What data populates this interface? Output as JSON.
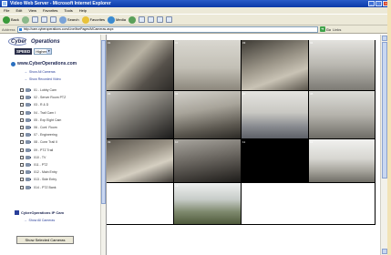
{
  "window": {
    "title": "Video Web Server - Microsoft Internet Explorer"
  },
  "menu": [
    "File",
    "Edit",
    "View",
    "Favorites",
    "Tools",
    "Help"
  ],
  "toolbar": {
    "back_label": "Back",
    "search_label": "Search",
    "favorites_label": "Favorites",
    "media_label": "Media"
  },
  "address": {
    "label": "Address",
    "url": "http://cam.cyberoperations.com/Live/livePages/MCameras.aspx",
    "go_label": "Go",
    "links_label": "Links"
  },
  "sidebar": {
    "logo_line1": "Cyber",
    "logo_line2": "Operations",
    "speed_label": "SPEED",
    "speed_value": "Highest",
    "site_title": "www.CyberOperations.com",
    "links": [
      "Show All Cameras",
      "Show Recorded Video"
    ],
    "cameras": [
      "01 - Lobby Cam",
      "02 - Server Room PTZ",
      "03 - R & D",
      "04 - Trail Cam I",
      "05 - Exp Eight Cam",
      "06 - Conf. Room",
      "07 - Engineering",
      "08 - Conn Trail II",
      "09 - PTZ Trail",
      "010 - TV",
      "011 - PTZ",
      "012 - Main Entry",
      "013 - Side Entry",
      "014 - PTZ Bank"
    ],
    "ip_title": "CyberOperations IP Cam",
    "ip_link": "Show All Cameras",
    "show_button": "Show Selected Cameras"
  },
  "grid_labels": [
    "01",
    "02",
    "03",
    "04",
    "05",
    "06",
    "07",
    "08",
    "09",
    "10",
    "11",
    "12",
    "13"
  ],
  "colors": {
    "titlebar": "#0b3aa8",
    "link": "#2a3f9a",
    "chrome": "#ece9d8"
  }
}
